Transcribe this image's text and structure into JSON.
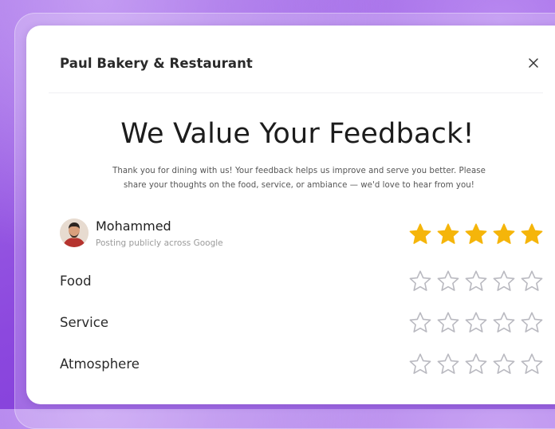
{
  "header": {
    "restaurant_name": "Paul Bakery & Restaurant"
  },
  "hero": {
    "title": "We Value Your Feedback!",
    "subtitle_line1": "Thank you for dining with us! Your feedback helps us improve and serve you better. Please",
    "subtitle_line2": "share your thoughts on the food, service, or ambiance — we'd love to hear from you!"
  },
  "user": {
    "name": "Mohammed",
    "posting_note": "Posting publicly across Google",
    "overall_rating": 5,
    "max_rating": 5
  },
  "categories": [
    {
      "label": "Food",
      "rating": 0
    },
    {
      "label": "Service",
      "rating": 0
    },
    {
      "label": "Atmosphere",
      "rating": 0
    }
  ],
  "icons": {
    "close": "close-icon",
    "star_filled": "star-filled-icon",
    "star_empty": "star-outline-icon"
  },
  "colors": {
    "star_filled": "#F5B50A",
    "star_outline": "#B9B9C0",
    "background": "#8C48DE"
  }
}
